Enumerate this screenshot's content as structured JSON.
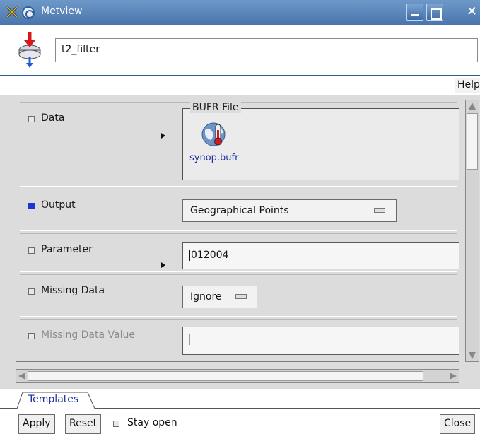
{
  "window": {
    "title": "Metview"
  },
  "header": {
    "name_value": "t2_filter"
  },
  "toolbar": {
    "help_label": "Help"
  },
  "rows": {
    "data": {
      "label": "Data",
      "checked": false
    },
    "output": {
      "label": "Output",
      "checked": true,
      "value": "Geographical Points"
    },
    "parameter": {
      "label": "Parameter",
      "checked": false,
      "value": "012004"
    },
    "missing_data": {
      "label": "Missing Data",
      "checked": false,
      "value": "Ignore"
    },
    "missing_data_value": {
      "label": "Missing Data Value",
      "checked": false,
      "value": ""
    }
  },
  "bufr": {
    "legend": "BUFR File",
    "filename": "synop.bufr",
    "icon": "thermometer-globe-icon"
  },
  "tabs": {
    "templates_label": "Templates"
  },
  "buttons": {
    "apply": "Apply",
    "reset": "Reset",
    "stay_open": "Stay open",
    "close": "Close"
  },
  "colors": {
    "titlebar": "#4a76ad",
    "accent_blue": "#1c36d6",
    "link_blue": "#1a2f9c",
    "panel_bg": "#dcdcdc"
  }
}
